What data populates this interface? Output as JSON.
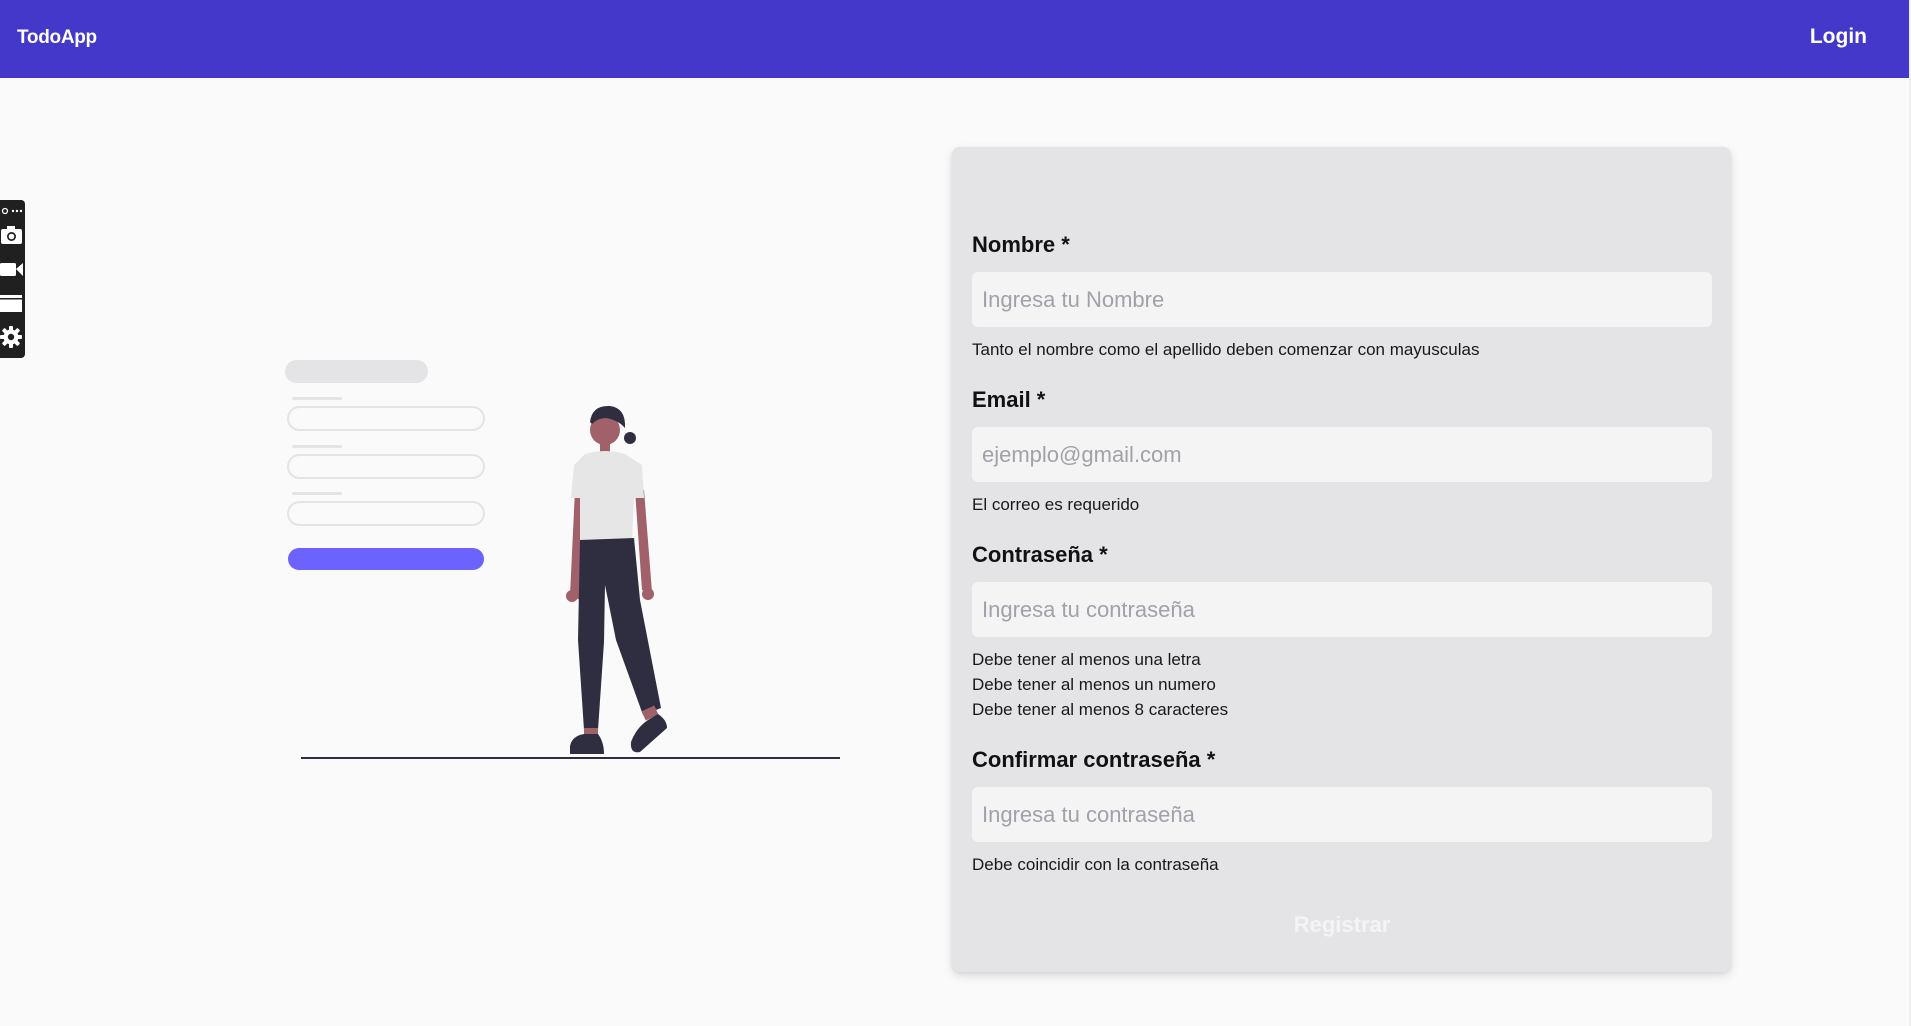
{
  "navbar": {
    "brand": "TodoApp",
    "login_label": "Login",
    "background": "#4338ca"
  },
  "toolbar": {
    "icons": [
      "link-icon",
      "camera-icon",
      "video-icon",
      "window-icon",
      "gear-icon"
    ]
  },
  "form": {
    "name": {
      "label": "Nombre *",
      "placeholder": "Ingresa tu Nombre",
      "hint": "Tanto el nombre como el apellido deben comenzar con mayusculas"
    },
    "email": {
      "label": "Email *",
      "placeholder": "ejemplo@gmail.com",
      "hint": "El correo es requerido"
    },
    "password": {
      "label": "Contraseña *",
      "placeholder": "Ingresa tu contraseña",
      "hints": [
        "Debe tener al menos una letra",
        "Debe tener al menos un numero",
        "Debe tener al menos 8 caracteres"
      ]
    },
    "confirm_password": {
      "label": "Confirmar contraseña *",
      "placeholder": "Ingresa tu contraseña",
      "hint": "Debe coincidir con la contraseña"
    },
    "submit_label": "Registrar"
  },
  "colors": {
    "accent": "#6c63ff",
    "figure_dark": "#2f2e41",
    "skin": "#a0616a",
    "card": "#e4e4e7"
  }
}
